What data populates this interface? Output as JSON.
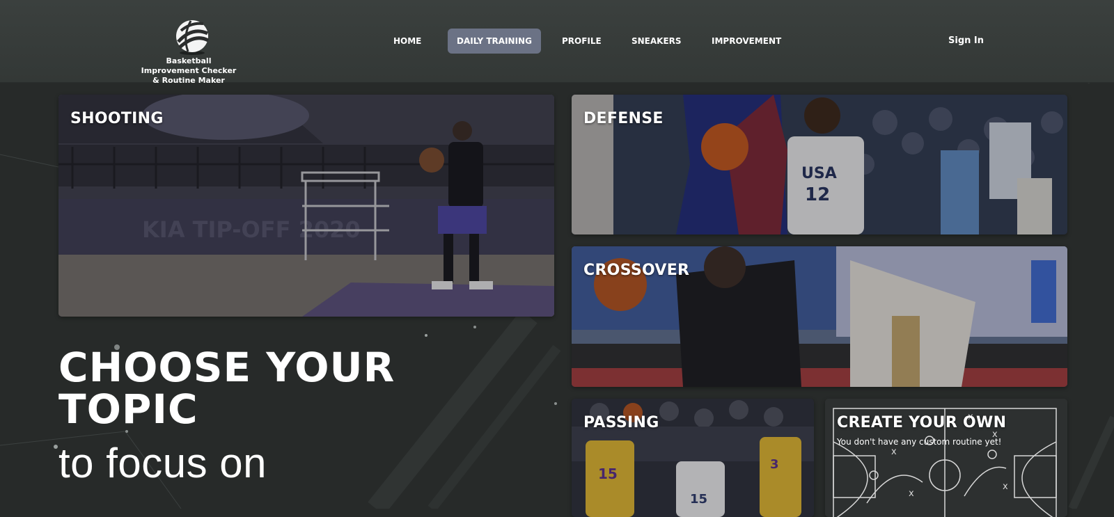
{
  "header": {
    "logo_text": "Basketball Improvement Checker & Routine Maker",
    "logo_icon": "basketball-icon",
    "nav": [
      {
        "label": "HOME",
        "active": false
      },
      {
        "label": "DAILY TRAINING",
        "active": true
      },
      {
        "label": "PROFILE",
        "active": false
      },
      {
        "label": "SNEAKERS",
        "active": false
      },
      {
        "label": "IMPROVEMENT",
        "active": false
      }
    ],
    "signin_label": "Sign In"
  },
  "hero": {
    "line1": "CHOOSE YOUR",
    "line2": "TOPIC",
    "sub": "to focus on"
  },
  "cards": {
    "shooting": "SHOOTING",
    "defense": "DEFENSE",
    "crossover": "CROSSOVER",
    "passing": "PASSING",
    "create": "CREATE YOUR OWN",
    "create_sub": "You don't have any custom routine yet!"
  },
  "colors": {
    "background": "#272a29",
    "header": "#383d3b",
    "nav_active": "#6b7285"
  }
}
